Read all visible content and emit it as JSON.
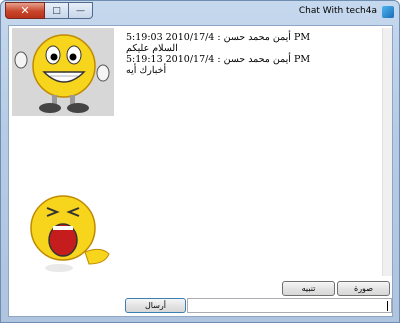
{
  "window": {
    "title": "Chat With tech4a",
    "close_glyph": "✕",
    "max_glyph": "□",
    "min_glyph": "—"
  },
  "messages": [
    {
      "header": "5:19:03 2010/17/4 : أيمن محمد حسن PM",
      "text": "السلام عليكم"
    },
    {
      "header": "5:19:13 2010/17/4 : أيمن محمد حسن PM",
      "text": "أخبارك أيه"
    }
  ],
  "buttons": {
    "image": "صورة",
    "nudge": "تنبيه",
    "send": "أرسال"
  },
  "input": {
    "value": ""
  },
  "colors": {
    "smiley": "#f7d51d",
    "smiley_shade": "#e0a800"
  },
  "icons": {
    "app": "app-icon",
    "avatar_top": "smiley-thumbs-up",
    "avatar_bottom": "smiley-laughing"
  }
}
